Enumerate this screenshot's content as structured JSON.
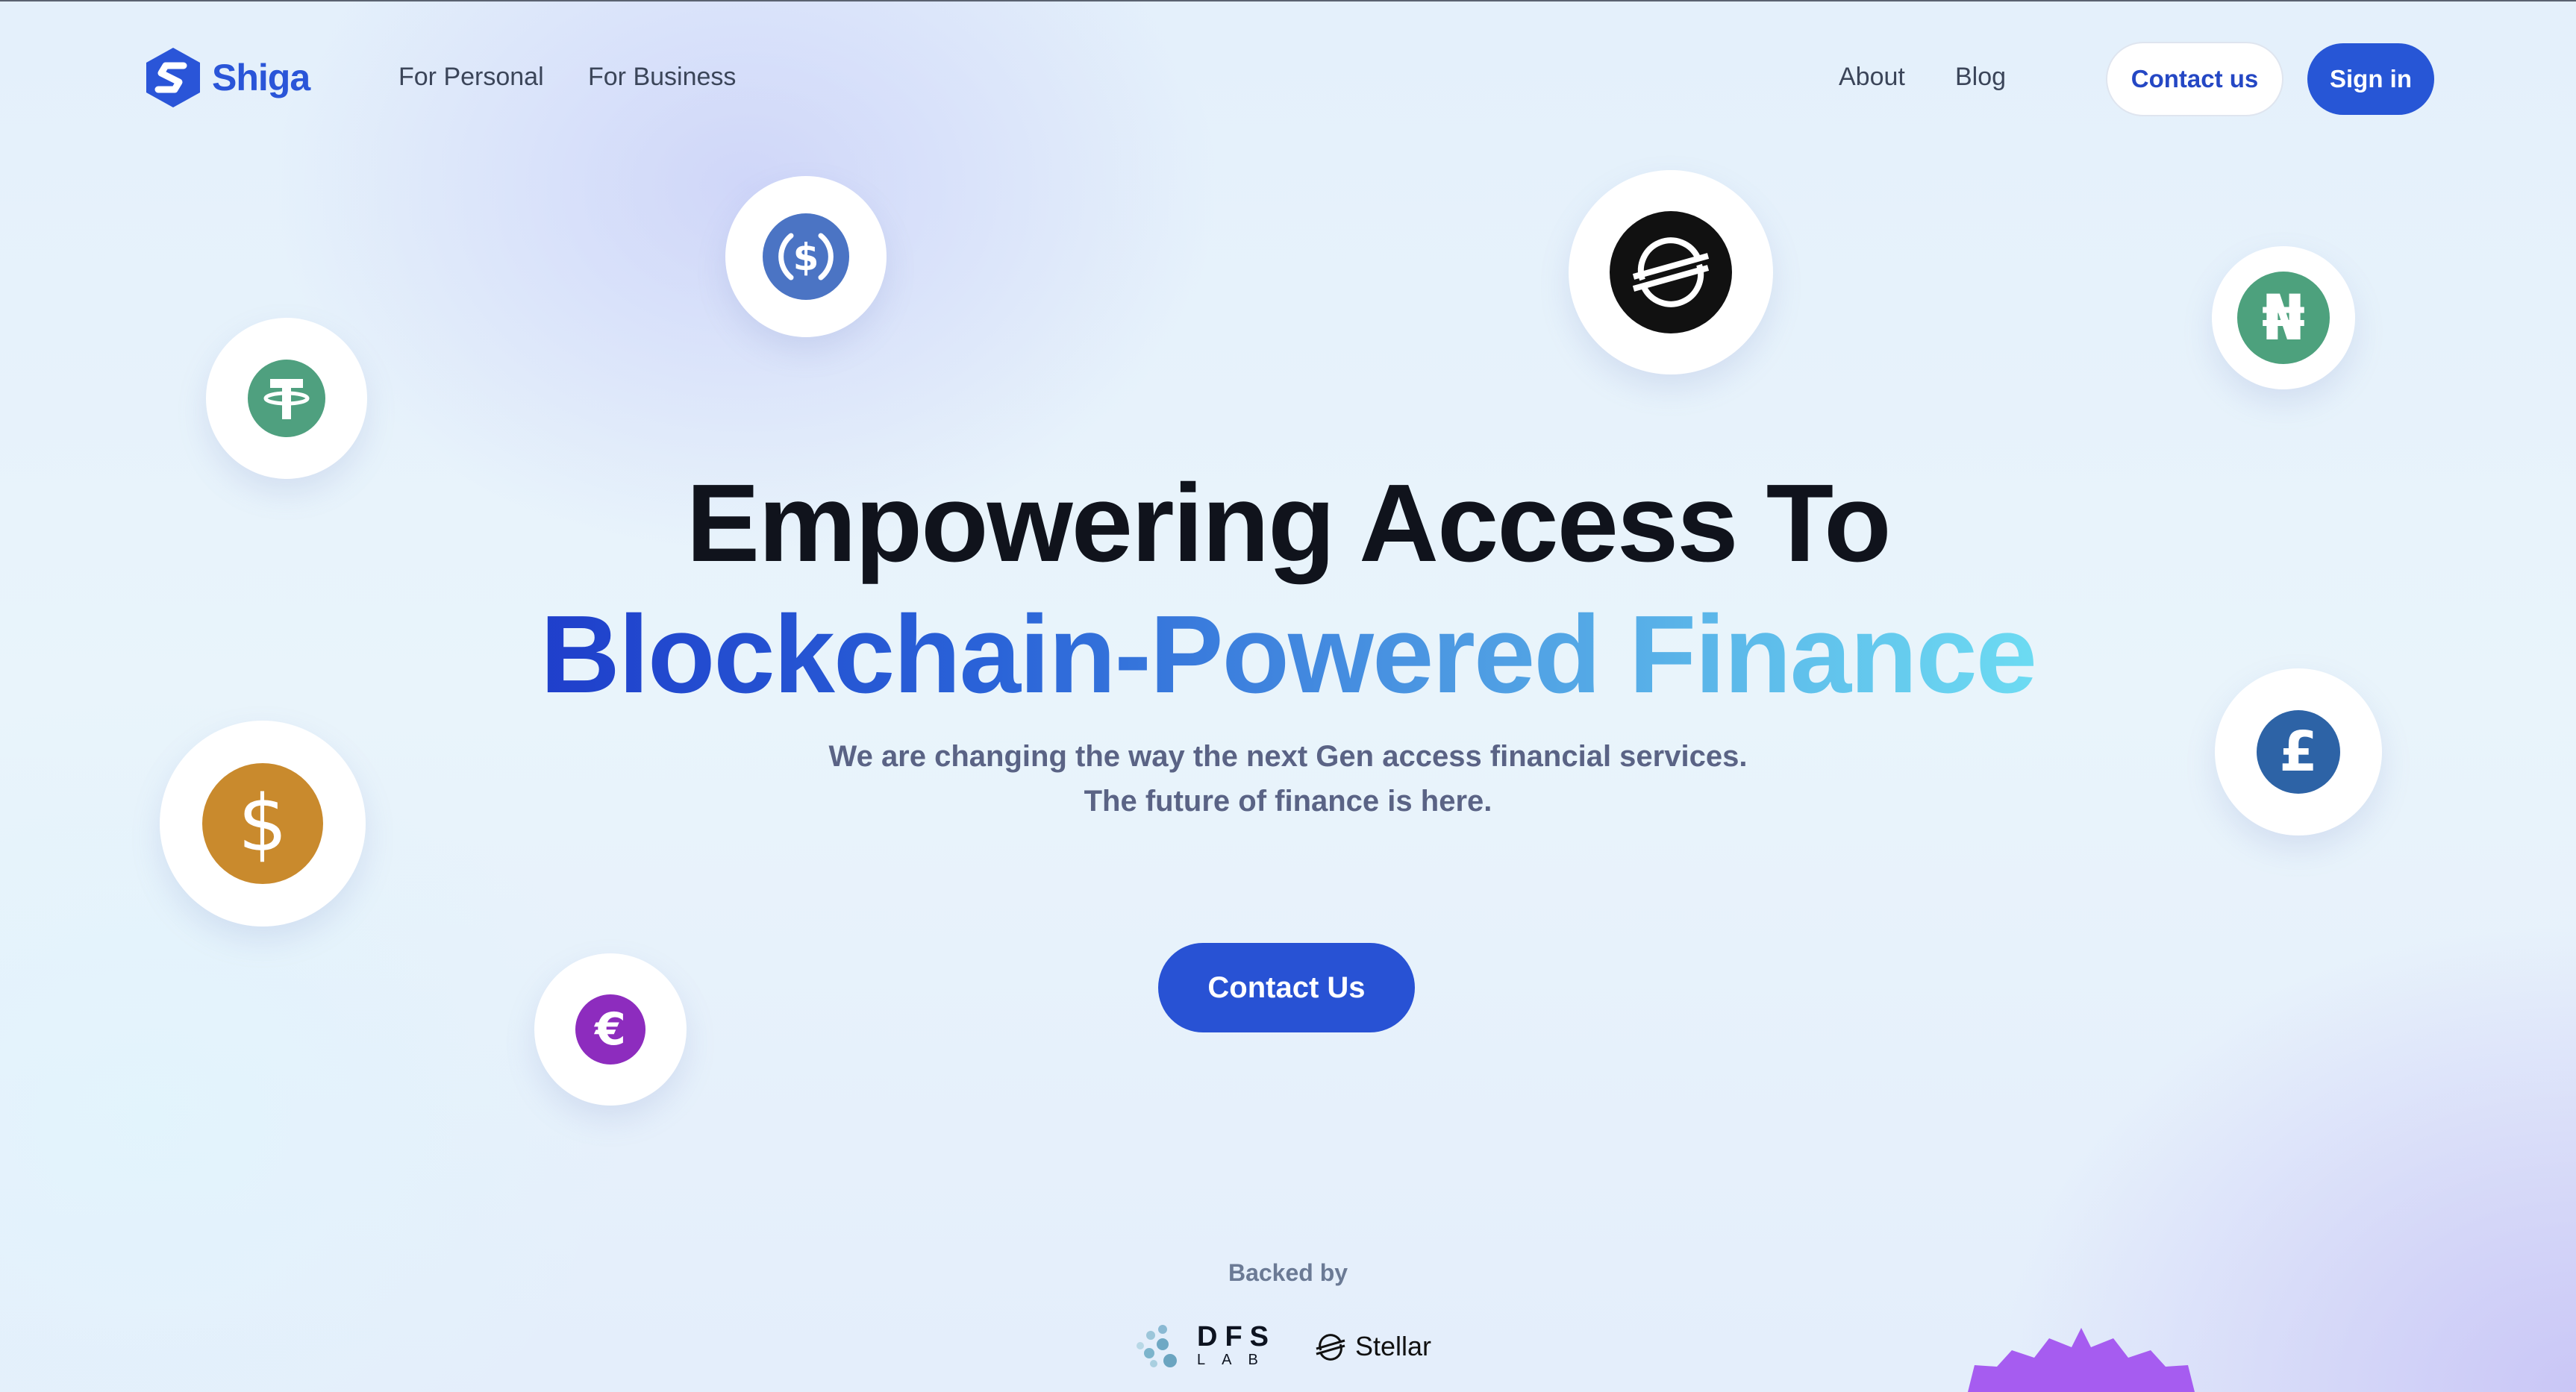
{
  "nav": {
    "brand": "Shiga",
    "links": [
      "For Personal",
      "For Business",
      "About",
      "Blog"
    ],
    "contact_label": "Contact us",
    "signin_label": "Sign in"
  },
  "hero": {
    "line1": "Empowering Access To",
    "line2": "Blockchain-Powered Finance",
    "sub1": "We are changing the way the next Gen access financial services.",
    "sub2": "The future of finance is here.",
    "cta_label": "Contact Us"
  },
  "coins": [
    {
      "name": "usdc-coin-icon",
      "symbol": "$",
      "color": "#4b74c4"
    },
    {
      "name": "tether-coin-icon",
      "symbol": "T",
      "color": "#4fa07f"
    },
    {
      "name": "stellar-coin-icon",
      "symbol": "",
      "color": "#111111"
    },
    {
      "name": "naira-coin-icon",
      "symbol": "₦",
      "color": "#4da17d"
    },
    {
      "name": "dollar-coin-icon",
      "symbol": "$",
      "color": "#c98a2d"
    },
    {
      "name": "pound-coin-icon",
      "symbol": "£",
      "color": "#2d63a6"
    },
    {
      "name": "euro-coin-icon",
      "symbol": "€",
      "color": "#8d2cbe"
    }
  ],
  "backers": {
    "label": "Backed by",
    "dfs_top": "DFS",
    "dfs_bottom": "LAB",
    "stellar": "Stellar"
  },
  "colors": {
    "brand": "#2a55d8",
    "button": "#2852d4",
    "heading": "#10131c",
    "subtext": "#5a6385"
  }
}
